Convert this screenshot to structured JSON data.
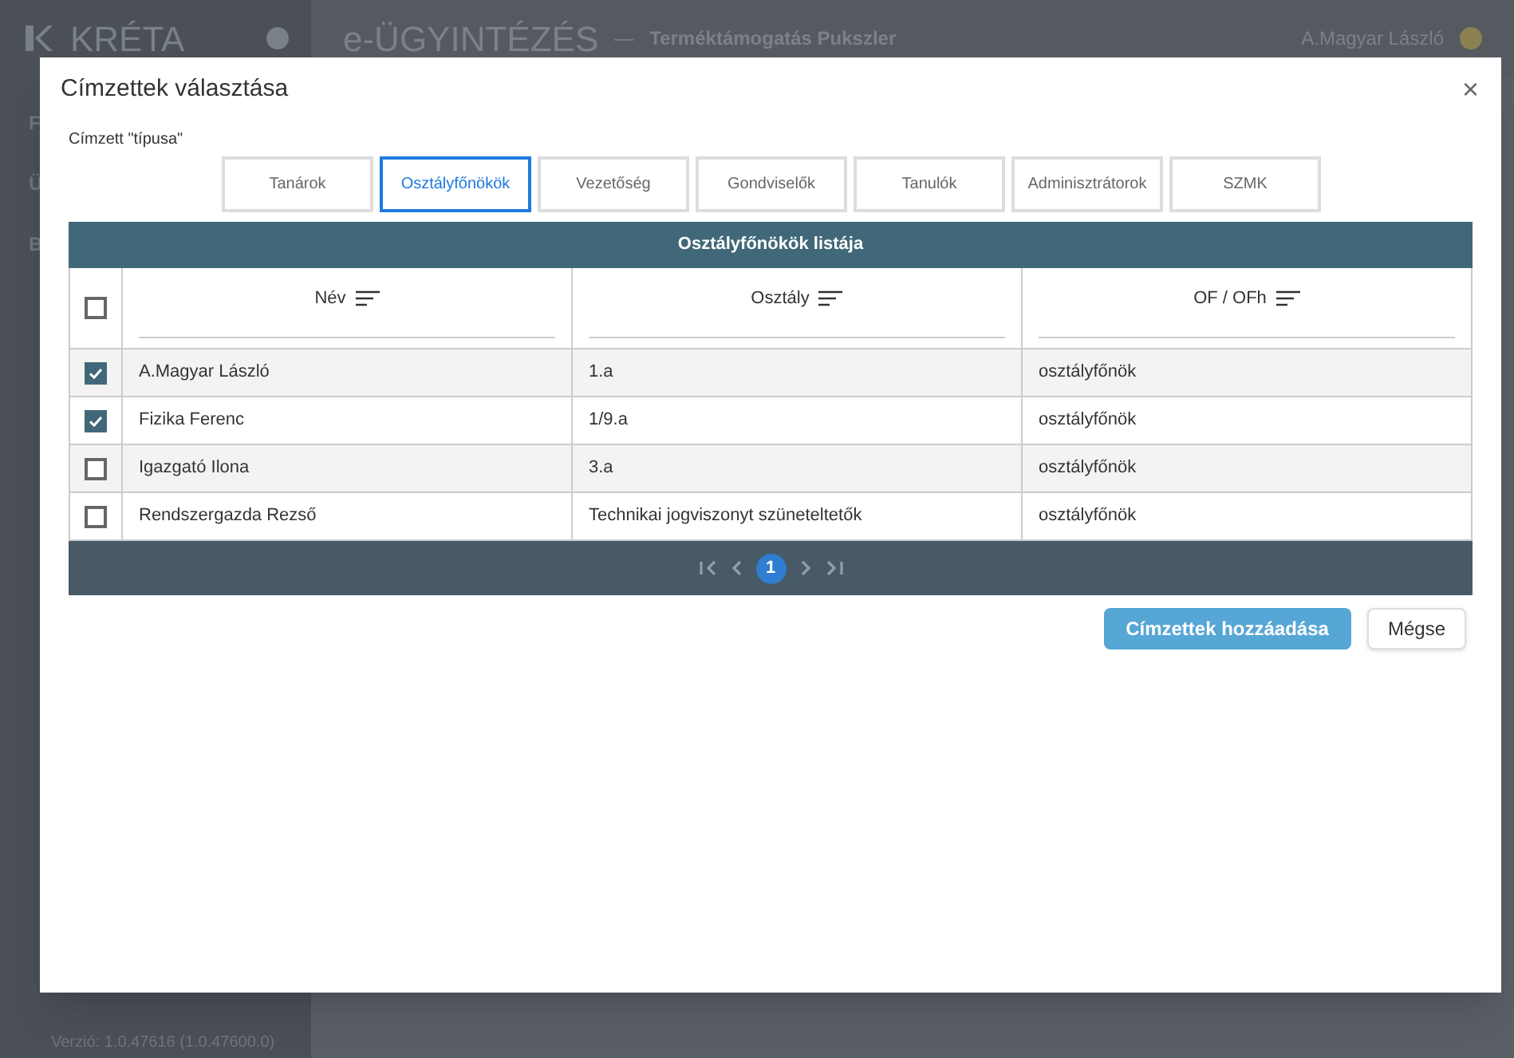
{
  "app": {
    "logo": "KRÉTA",
    "module": "e-ÜGYINTÉZÉS",
    "separator": "—",
    "subtitle": "Terméktámogatás Pukszler",
    "user": "A.Magyar László",
    "sidebar_items": [
      "F",
      "Ü",
      "B"
    ],
    "version": "Verzió: 1.0.47616 (1.0.47600.0)"
  },
  "dialog": {
    "title": "Címzettek választása",
    "close": "×",
    "type_label": "Címzett \"típusa\"",
    "tabs": [
      {
        "label": "Tanárok",
        "selected": false
      },
      {
        "label": "Osztályfőnökök",
        "selected": true
      },
      {
        "label": "Vezetőség",
        "selected": false
      },
      {
        "label": "Gondviselők",
        "selected": false
      },
      {
        "label": "Tanulók",
        "selected": false
      },
      {
        "label": "Adminisztrátorok",
        "selected": false
      },
      {
        "label": "SZMK",
        "selected": false
      }
    ],
    "table": {
      "title": "Osztályfőnökök listája",
      "select_all_checked": false,
      "columns": [
        "Név",
        "Osztály",
        "OF / OFh"
      ],
      "rows": [
        {
          "checked": true,
          "cells": [
            "A.Magyar László",
            "1.a",
            "osztályfőnök"
          ]
        },
        {
          "checked": true,
          "cells": [
            "Fizika Ferenc",
            "1/9.a",
            "osztályfőnök"
          ]
        },
        {
          "checked": false,
          "cells": [
            "Igazgató Ilona",
            "3.a",
            "osztályfőnök"
          ]
        },
        {
          "checked": false,
          "cells": [
            "Rendszergazda Rezső",
            "Technikai jogviszonyt szüneteltetők",
            "osztályfőnök"
          ]
        }
      ],
      "pages": [
        {
          "label": "1",
          "selected": true
        }
      ]
    },
    "buttons": [
      {
        "kind": "primary",
        "label": "Címzettek hozzáadása"
      },
      {
        "kind": "secondary",
        "label": "Mégse"
      }
    ]
  }
}
